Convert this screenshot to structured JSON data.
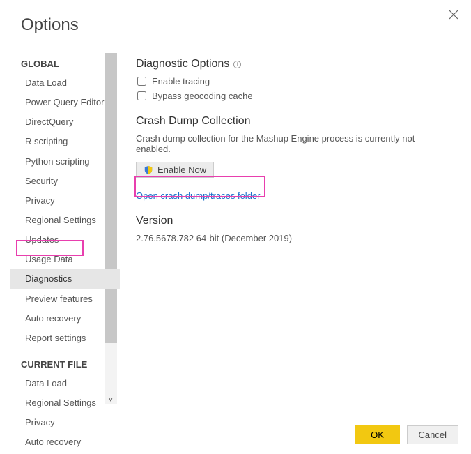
{
  "title": "Options",
  "sidebar": {
    "globalLabel": "GLOBAL",
    "currentFileLabel": "CURRENT FILE",
    "global": [
      "Data Load",
      "Power Query Editor",
      "DirectQuery",
      "R scripting",
      "Python scripting",
      "Security",
      "Privacy",
      "Regional Settings",
      "Updates",
      "Usage Data",
      "Diagnostics",
      "Preview features",
      "Auto recovery",
      "Report settings"
    ],
    "currentFile": [
      "Data Load",
      "Regional Settings",
      "Privacy",
      "Auto recovery"
    ],
    "selectedGlobalIndex": 10
  },
  "diag": {
    "heading": "Diagnostic Options",
    "enableTracing": "Enable tracing",
    "bypassGeocoding": "Bypass geocoding cache",
    "crashHeading": "Crash Dump Collection",
    "crashText": "Crash dump collection for the Mashup Engine process is currently not enabled.",
    "enableNow": "Enable Now",
    "openFolderLink": "Open crash dump/traces folder",
    "versionHeading": "Version",
    "versionText": "2.76.5678.782 64-bit (December 2019)"
  },
  "footer": {
    "ok": "OK",
    "cancel": "Cancel"
  }
}
